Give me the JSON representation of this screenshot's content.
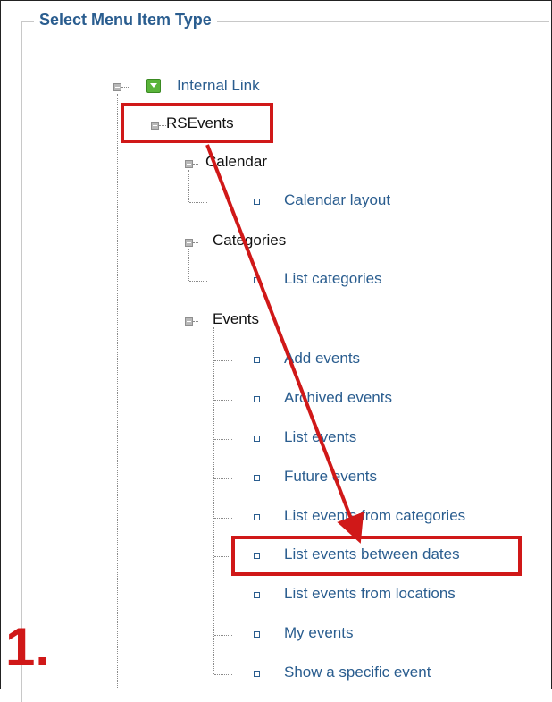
{
  "panel": {
    "title": "Select Menu Item Type"
  },
  "tree": {
    "root": "Internal Link",
    "component": "RSEvents",
    "calendar": {
      "label": "Calendar",
      "items": [
        "Calendar layout"
      ]
    },
    "categories": {
      "label": "Categories",
      "items": [
        "List categories"
      ]
    },
    "events": {
      "label": "Events",
      "items": [
        "Add events",
        "Archived events",
        "List events",
        "Future events",
        "List events from categories",
        "List events between dates",
        "List events from locations",
        "My events",
        "Show a specific event"
      ]
    }
  },
  "annotation": {
    "step": "1.",
    "color": "#d01818"
  },
  "colors": {
    "link": "#2a5d8f",
    "legend": "#2a5d8f",
    "green_icon": "#5ab43a"
  }
}
